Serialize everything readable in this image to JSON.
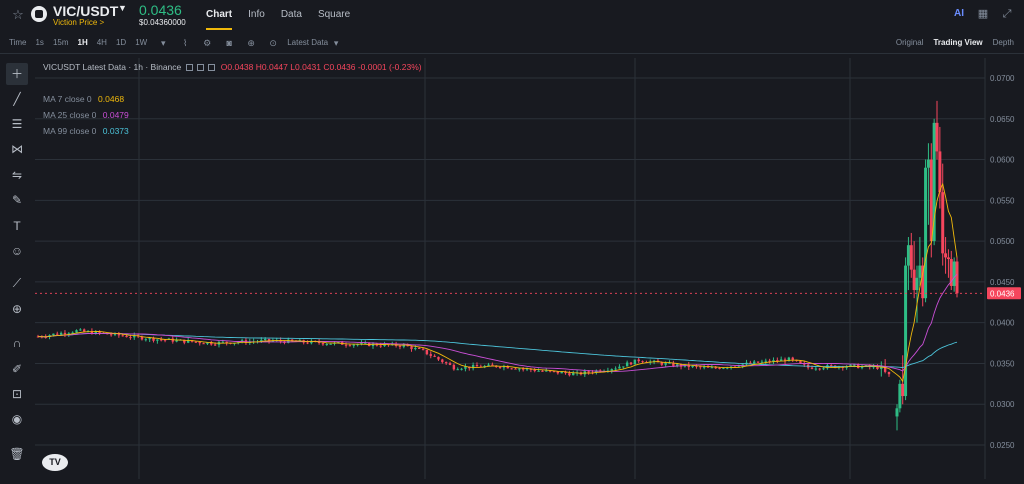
{
  "header": {
    "symbol": "VIC/USDT",
    "subtitle": "Viction Price >",
    "price": "0.0436",
    "price_usd": "$0.04360000",
    "tabs": [
      "Chart",
      "Info",
      "Data",
      "Square"
    ],
    "active_tab": "Chart",
    "right_icons": [
      "ai-icon",
      "grid-icon",
      "collapse-icon"
    ],
    "colors": {
      "accent": "#f0b90b",
      "up": "#2ebd85",
      "down": "#f6465d"
    }
  },
  "toolbar": {
    "timeframes": [
      "Time",
      "1s",
      "15m",
      "1H",
      "4H",
      "1D",
      "1W"
    ],
    "active_timeframe": "1H",
    "tool_icons": [
      "dropdown-icon",
      "indicator-icon",
      "settings-icon",
      "camera-icon",
      "add-icon",
      "plus-circle-icon"
    ],
    "latest_label": "Latest Data",
    "views": [
      "Original",
      "Trading View",
      "Depth"
    ],
    "active_view": "Trading View"
  },
  "sidebar": {
    "tools": [
      "crosshair-icon",
      "trend-line-icon",
      "fib-icon",
      "pattern-icon",
      "projection-icon",
      "brush-icon",
      "text-icon",
      "emoji-icon",
      "ruler-icon",
      "zoom-in-icon",
      "magnet-icon",
      "lock-drawing-icon",
      "unlock-icon",
      "eye-icon",
      "trash-icon"
    ]
  },
  "legend": {
    "title": "VICUSDT Latest Data · 1h · Binance",
    "ohlc": "O0.0438 H0.0447 L0.0431 C0.0436 -0.0001 (-0.23%)",
    "ma7_label": "MA 7 close 0",
    "ma7_value": "0.0468",
    "ma25_label": "MA 25 close 0",
    "ma25_value": "0.0479",
    "ma99_label": "MA 99 close 0",
    "ma99_value": "0.0373",
    "ma7_color": "#f0b90b",
    "ma25_color": "#c94fd6",
    "ma99_color": "#4cc3d9"
  },
  "watermark": "TV",
  "chart_data": {
    "type": "candlestick",
    "title": "VICUSDT Latest Data · 1h · Binance",
    "ylim": [
      0.024,
      0.072
    ],
    "y_ticks": [
      "0.0700",
      "0.0650",
      "0.0600",
      "0.0550",
      "0.0500",
      "0.0450",
      "0.0400",
      "0.0350",
      "0.0300",
      "0.0250"
    ],
    "last_price": "0.0436",
    "ma_series": [
      {
        "name": "MA 7 close 0",
        "last": 0.0468,
        "color": "#f0b90b"
      },
      {
        "name": "MA 25 close 0",
        "last": 0.0479,
        "color": "#c94fd6"
      },
      {
        "name": "MA 99 close 0",
        "last": 0.0373,
        "color": "#4cc3d9"
      }
    ]
  }
}
